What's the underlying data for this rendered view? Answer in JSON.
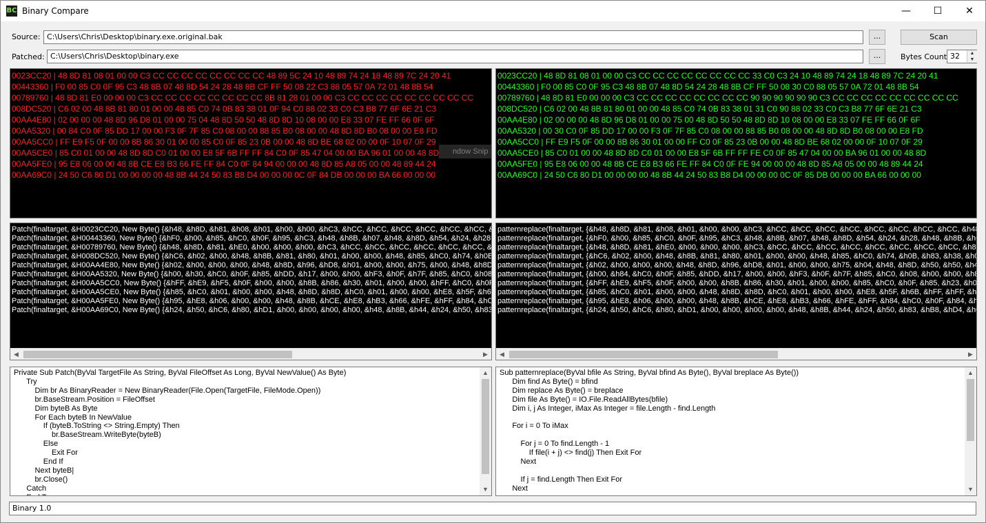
{
  "window": {
    "title": "Binary Compare",
    "icon_text": "BC",
    "minimize": "—",
    "maximize": "☐",
    "close": "✕"
  },
  "form": {
    "source_label": "Source:",
    "source_value": "C:\\Users\\Chris\\Desktop\\binary.exe.original.bak",
    "patched_label": "Patched:",
    "patched_value": "C:\\Users\\Chris\\Desktop\\binary.exe",
    "browse_label": "...",
    "scan_label": "Scan",
    "bytes_count_label": "Bytes Count:",
    "bytes_count_value": "32"
  },
  "overlay_ghost": "ndow Snip",
  "hex_left": [
    "0023CC20 | 48 8D 81 08 01 00 00 C3 CC CC CC CC CC CC CC CC 48 89 5C 24 10 48 89 74 24 18 48 89 7C 24 20 41",
    "00443360 | F0 00 85 C0 0F 95 C3 48 8B 07 48 8D 54 24 28 48 8B CF FF 50 08 22 C3 88 05 57 0A 72 01 48 8B 54",
    "00789760 | 48 8D 81 E0 00 00 00 C3 CC CC CC CC CC CC CC CC 8B 81 28 01 00 00 C3 CC CC CC CC CC CC CC CC CC",
    "008DC520 | C6 02 00 48 8B 81 80 01 00 00 48 85 C0 74 0B 83 38 01 0F 94 C0 88 02 33 C0 C3 B8 77 6F 6E 21 C3",
    "00AA4E80 | 02 00 00 00 48 8D 96 D8 01 00 00 75 04 48 8D 50 50 48 8D 8D 10 08 00 00 E8 33 07 FE FF 66 0F 6F",
    "00AA5320 | 00 84 C0 0F 85 DD 17 00 00 F3 0F 7F 85 C0 08 00 00 88 85 B0 08 00 00 48 8D 8D B0 08 00 00 E8 FD",
    "00AA5CC0 | FF E9 F5 0F 00 00 8B 86 30 01 00 00 85 C0 0F 85 23 0B 00 00 48 8D BE 68 02 00 00 0F 10 07 0F 29",
    "00AA5CE0 | 85 C0 01 00 00 48 8D 8D C0 01 00 00 E8 5F 6B FF FF 84 C0 0F 85 47 04 00 00 BA 96 01 00 00 48 8D",
    "00AA5FE0 | 95 E8 06 00 00 48 8B CE E8 B3 66 FE FF 84 C0 0F 84 94 00 00 00 48 8D 85 A8 05 00 00 48 89 44 24",
    "00AA69C0 | 24 50 C6 80 D1 00 00 00 00 48 8B 44 24 50 83 B8 D4 00 00 00 0C 0F 84 DB 00 00 00 BA 66 00 00 00"
  ],
  "hex_right": [
    "0023CC20 | 48 8D 81 08 01 00 00 C3 CC CC CC CC CC CC CC CC 33 C0 C3 24 10 48 89 74 24 18 48 89 7C 24 20 41",
    "00443360 | F0 00 85 C0 0F 95 C3 48 8B 07 48 8D 54 24 28 48 8B CF FF 50 08 30 C0 88 05 57 0A 72 01 48 8B 54",
    "00789760 | 48 8D 81 E0 00 00 00 C3 CC CC CC CC CC CC CC CC 90 90 90 90 90 90 C3 CC CC CC CC CC CC CC CC CC",
    "008DC520 | C6 02 00 48 8B 81 80 01 00 00 48 85 C0 74 0B 83 38 01 31 C0 90 88 02 33 C0 C3 B8 77 6F 6E 21 C3",
    "00AA4E80 | 02 00 00 00 48 8D 96 D8 01 00 00 75 00 48 8D 50 50 48 8D 8D 10 08 00 00 E8 33 07 FE FF 66 0F 6F",
    "00AA5320 | 00 30 C0 0F 85 DD 17 00 00 F3 0F 7F 85 C0 08 00 00 88 85 B0 08 00 00 48 8D 8D B0 08 00 00 E8 FD",
    "00AA5CC0 | FF E9 F5 0F 00 00 8B 86 30 01 00 00 FF C0 0F 85 23 0B 00 00 48 8D BE 68 02 00 00 0F 10 07 0F 29",
    "00AA5CE0 | 85 C0 01 00 00 48 8D 8D C0 01 00 00 E8 5F 6B FF FF FE C0 0F 85 47 04 00 00 BA 96 01 00 00 48 8D",
    "00AA5FE0 | 95 E8 06 00 00 48 8B CE E8 B3 66 FE FF 84 C0 0F FE 94 00 00 00 48 8D 85 A8 05 00 00 48 89 44 24",
    "00AA69C0 | 24 50 C6 80 D1 00 00 00 00 48 8B 44 24 50 83 B8 D4 00 00 00 0C 0F 85 DB 00 00 00 BA 66 00 00 00"
  ],
  "patch_left": [
    "Patch(finaltarget, &H0023CC20, New Byte() {&h48, &h8D, &h81, &h08, &h01, &h00, &h00, &hC3, &hCC, &hCC, &hCC, &hCC, &hCC, &hCC, &hCC, &hCC, &hCC,",
    "Patch(finaltarget, &H00443360, New Byte() {&hF0, &h00, &h85, &hC0, &h0F, &h95, &hC3, &h48, &h8B, &h07, &h48, &h8D, &h54, &h24, &h28, &h48, &h8B,",
    "Patch(finaltarget, &H00789760, New Byte() {&h48, &h8D, &h81, &hE0, &h00, &h00, &h00, &hC3, &hCC, &hCC, &hCC, &hCC, &hCC, &hCC, &hCC, &hCC, &hCC,",
    "Patch(finaltarget, &H008DC520, New Byte() {&hC6, &h02, &h00, &h48, &h8B, &h81, &h80, &h01, &h00, &h00, &h48, &h85, &hC0, &h74, &h0B, &h83, &h38,",
    "Patch(finaltarget, &H00AA4E80, New Byte() {&h02, &h00, &h00, &h00, &h48, &h8D, &h96, &hD8, &h01, &h00, &h00, &h75, &h00, &h48, &h8D, &h50, &h50,",
    "Patch(finaltarget, &H00AA5320, New Byte() {&h00, &h30, &hC0, &h0F, &h85, &hDD, &h17, &h00, &h00, &hF3, &h0F, &h7F, &h85, &hC0, &h08, &h00, &h00,",
    "Patch(finaltarget, &H00AA5CC0, New Byte() {&hFF, &hE9, &hF5, &h0F, &h00, &h00, &h8B, &h86, &h30, &h01, &h00, &h00, &hFF, &hC0, &h0F, &h85, &h23,",
    "Patch(finaltarget, &H00AA5CE0, New Byte() {&h85, &hC0, &h01, &h00, &h00, &h48, &h8D, &h8D, &hC0, &h01, &h00, &h00, &hE8, &h5F, &h6B, &hFF, &hFF,",
    "Patch(finaltarget, &H00AA5FE0, New Byte() {&h95, &hE8, &h06, &h00, &h00, &h48, &h8B, &hCE, &hE8, &hB3, &h66, &hFE, &hFF, &h84, &hC0, &h0F, &hFE,",
    "Patch(finaltarget, &H00AA69C0, New Byte() {&h24, &h50, &hC6, &h80, &hD1, &h00, &h00, &h00, &h00, &h48, &h8B, &h44, &h24, &h50, &h83, &hB8, &hD4,"
  ],
  "patch_right": [
    "patternreplace(finaltarget, {&h48, &h8D, &h81, &h08, &h01, &h00, &h00, &hC3, &hCC, &hCC, &hCC, &hCC, &hCC, &hCC, &hCC, &hCC, &h48, &h89, &h",
    "patternreplace(finaltarget, {&hF0, &h00, &h85, &hC0, &h0F, &h95, &hC3, &h48, &h8B, &h07, &h48, &h8D, &h54, &h24, &h28, &h48, &h8B, &hCF, &hFF",
    "patternreplace(finaltarget, {&h48, &h8D, &h81, &hE0, &h00, &h00, &h00, &hC3, &hCC, &hCC, &hCC, &hCC, &hCC, &hCC, &hCC, &hCC, &h8B, &h81, &h",
    "patternreplace(finaltarget, {&hC6, &h02, &h00, &h48, &h8B, &h81, &h80, &h01, &h00, &h00, &h48, &h85, &hC0, &h74, &h0B, &h83, &h38, &h01, &h0F",
    "patternreplace(finaltarget, {&h02, &h00, &h00, &h00, &h48, &h8D, &h96, &hD8, &h01, &h00, &h00, &h75, &h04, &h48, &h8D, &h50, &h50, &h48, &h8D",
    "patternreplace(finaltarget, {&h00, &h84, &hC0, &h0F, &h85, &hDD, &h17, &h00, &h00, &hF3, &h0F, &h7F, &h85, &hC0, &h08, &h00, &h00, &h88, &h85",
    "patternreplace(finaltarget, {&hFF, &hE9, &hF5, &h0F, &h00, &h00, &h8B, &h86, &h30, &h01, &h00, &h00, &h85, &hC0, &h0F, &h85, &h23, &h0B, &h00",
    "patternreplace(finaltarget, {&h85, &hC0, &h01, &h00, &h00, &h48, &h8D, &h8D, &hC0, &h01, &h00, &h00, &hE8, &h5F, &h6B, &hFF, &hFF, &h84, &hC0",
    "patternreplace(finaltarget, {&h95, &hE8, &h06, &h00, &h00, &h48, &h8B, &hCE, &hE8, &hB3, &h66, &hFE, &hFF, &h84, &hC0, &h0F, &h84, &h94, &h00",
    "patternreplace(finaltarget, {&h24, &h50, &hC6, &h80, &hD1, &h00, &h00, &h00, &h00, &h48, &h8B, &h44, &h24, &h50, &h83, &hB8, &hD4, &h00, &h00"
  ],
  "code_left": "Private Sub Patch(ByVal TargetFile As String, ByVal FileOffset As Long, ByVal NewValue() As Byte)\n      Try\n          Dim br As BinaryReader = New BinaryReader(File.Open(TargetFile, FileMode.Open))\n          br.BaseStream.Position = FileOffset\n          Dim byteB As Byte\n          For Each byteB In NewValue\n              If (byteB.ToString <> String.Empty) Then\n                  br.BaseStream.WriteByte(byteB)\n              Else\n                  Exit For\n              End If\n          Next byteB|\n          br.Close()\n      Catch\n      End Try",
  "code_right": "Sub patternreplace(ByVal bfile As String, ByVal bfind As Byte(), ByVal breplace As Byte())\n      Dim find As Byte() = bfind\n      Dim replace As Byte() = breplace\n      Dim file As Byte() = IO.File.ReadAllBytes(bfile)\n      Dim i, j As Integer, iMax As Integer = file.Length - find.Length\n\n      For i = 0 To iMax\n\n          For j = 0 To find.Length - 1\n              If file(i + j) <> find(j) Then Exit For\n          Next\n\n          If j = find.Length Then Exit For\n      Next",
  "status": "Binary 1.0",
  "colors": {
    "removed": "#ff2020",
    "added": "#20ff20"
  }
}
